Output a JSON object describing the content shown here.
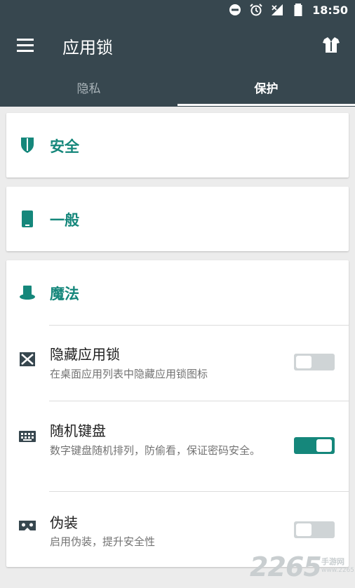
{
  "status_bar": {
    "time": "18:50"
  },
  "app_bar": {
    "title": "应用锁"
  },
  "tabs": [
    {
      "label": "隐私",
      "selected": false
    },
    {
      "label": "保护",
      "selected": true
    }
  ],
  "sections": {
    "security": {
      "title": "安全"
    },
    "general": {
      "title": "一般"
    },
    "magic": {
      "title": "魔法",
      "items": [
        {
          "title": "隐藏应用锁",
          "subtitle": "在桌面应用列表中隐藏应用锁图标",
          "enabled": false
        },
        {
          "title": "随机键盘",
          "subtitle": "数字键盘随机排列，防偷看，保证密码安全。",
          "enabled": true
        },
        {
          "title": "伪装",
          "subtitle": "启用伪装，提升安全性",
          "enabled": false
        }
      ]
    }
  },
  "watermark": {
    "number": "2265",
    "text": "手游网",
    "url": "www.2265.com"
  },
  "colors": {
    "toolbar": "#37474f",
    "accent": "#15877b",
    "toggle_off": "#cfd4d6"
  }
}
